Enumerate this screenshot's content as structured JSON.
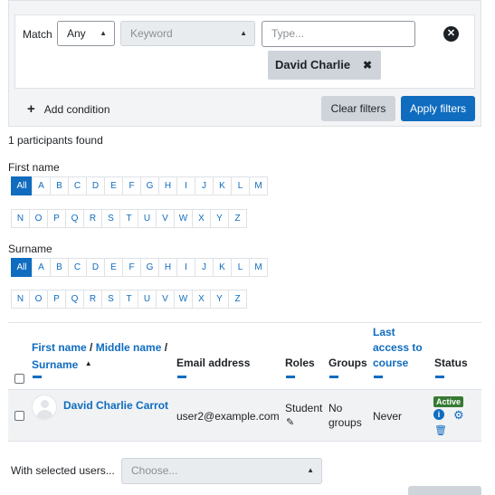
{
  "filter": {
    "match_label": "Match",
    "match_value": "Any",
    "keyword_placeholder": "Keyword",
    "type_placeholder": "Type...",
    "chip_label": "David Charlie",
    "add_condition": "Add condition",
    "clear_filters": "Clear filters",
    "apply_filters": "Apply filters"
  },
  "found_text": "1 participants found",
  "initials": {
    "first_name_label": "First name",
    "surname_label": "Surname",
    "all": "All",
    "row1": [
      "A",
      "B",
      "C",
      "D",
      "E",
      "F",
      "G",
      "H",
      "I",
      "J",
      "K",
      "L",
      "M"
    ],
    "row2": [
      "N",
      "O",
      "P",
      "Q",
      "R",
      "S",
      "T",
      "U",
      "V",
      "W",
      "X",
      "Y",
      "Z"
    ]
  },
  "table": {
    "col_name_a": "First name",
    "col_name_sep1": " / ",
    "col_name_b": "Middle name",
    "col_name_sep2": " /",
    "col_name_c": "Surname",
    "col_email": "Email address",
    "col_roles": "Roles",
    "col_groups": "Groups",
    "col_last_access": "Last access to course",
    "col_status": "Status",
    "row": {
      "name": "David Charlie Carrot",
      "email": "user2@example.com",
      "role": "Student",
      "groups": "No groups",
      "last_access": "Never",
      "status": "Active"
    }
  },
  "bulk": {
    "label": "With selected users...",
    "placeholder": "Choose..."
  },
  "colors": {
    "accent": "#0f6cbf",
    "active_badge": "#357a32"
  },
  "icons": [
    "close-circle-icon",
    "times-icon",
    "plus-icon",
    "sort-up-icon",
    "pencil-icon",
    "info-icon",
    "gear-icon",
    "trash-icon",
    "avatar-icon"
  ]
}
